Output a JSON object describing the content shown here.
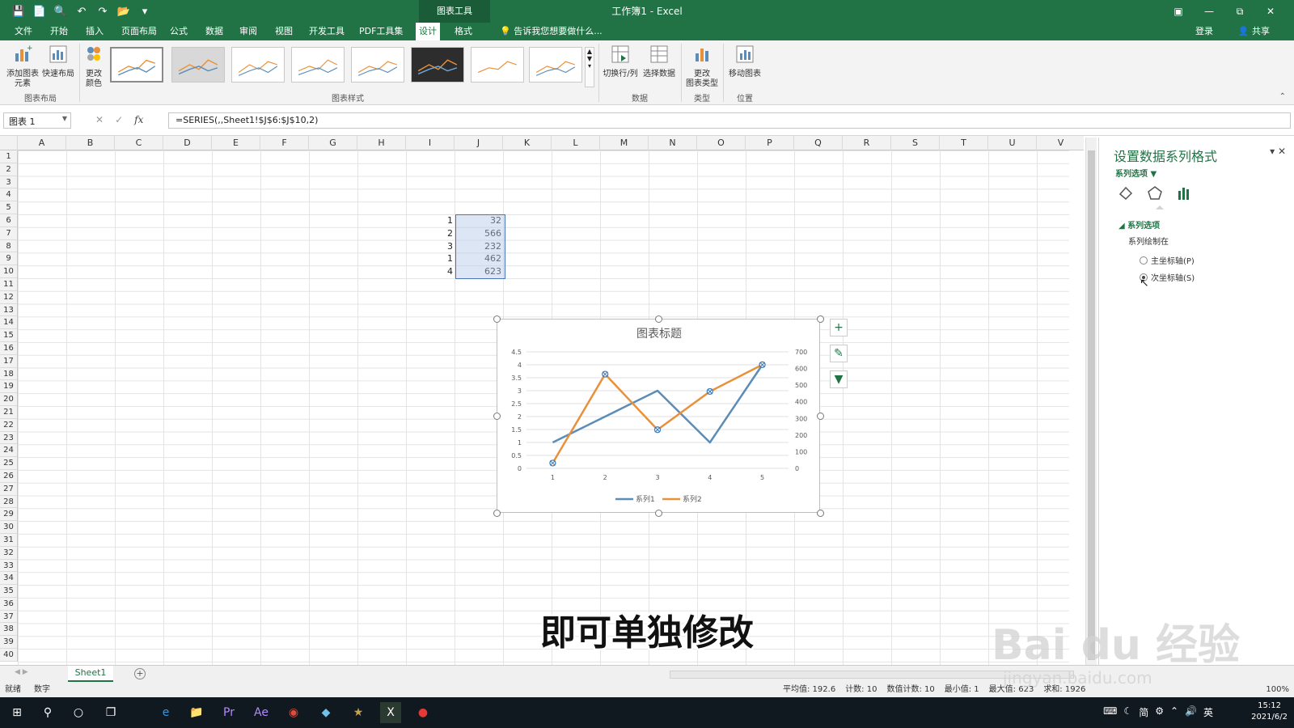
{
  "titlebar": {
    "tool_tab": "图表工具",
    "title": "工作簿1 - Excel"
  },
  "tabs": [
    "文件",
    "开始",
    "插入",
    "页面布局",
    "公式",
    "数据",
    "审阅",
    "视图",
    "开发工具",
    "PDF工具集",
    "设计",
    "格式"
  ],
  "active_tab": "设计",
  "tell_me": "告诉我您想要做什么...",
  "login": "登录",
  "share": "共享",
  "ribbon": {
    "add_element": "添加图表\n元素",
    "quick_layout": "快速布局",
    "change_color": "更改\n颜色",
    "group_layout": "图表布局",
    "group_styles": "图表样式",
    "switch_row_col": "切换行/列",
    "select_data": "选择数据",
    "group_data": "数据",
    "change_type": "更改\n图表类型",
    "group_type": "类型",
    "move_chart": "移动图表",
    "group_location": "位置"
  },
  "formula_bar": {
    "name_box": "图表 1",
    "formula": "=SERIES(,,Sheet1!$J$6:$J$10,2)"
  },
  "columns": [
    "A",
    "B",
    "C",
    "D",
    "E",
    "F",
    "G",
    "H",
    "I",
    "J",
    "K",
    "L",
    "M",
    "N",
    "O",
    "P",
    "Q",
    "R",
    "S",
    "T",
    "U",
    "V"
  ],
  "rows": [
    "1",
    "2",
    "3",
    "4",
    "5",
    "6",
    "7",
    "8",
    "9",
    "10",
    "11",
    "12",
    "13",
    "14",
    "15",
    "16",
    "17",
    "18",
    "19",
    "20",
    "21",
    "22",
    "23",
    "24",
    "25",
    "26",
    "27",
    "28",
    "29",
    "30",
    "31",
    "32",
    "33",
    "34",
    "35",
    "36",
    "37",
    "38",
    "39",
    "40"
  ],
  "cells": {
    "col_i": [
      "1",
      "2",
      "3",
      "1",
      "4"
    ],
    "col_j": [
      "32",
      "566",
      "232",
      "462",
      "623"
    ]
  },
  "chart_data": {
    "type": "line",
    "title": "图表标题",
    "categories": [
      1,
      2,
      3,
      4,
      5
    ],
    "series": [
      {
        "name": "系列1",
        "values": [
          1,
          2,
          3,
          1,
          4
        ],
        "axis": "primary",
        "color": "#5b8db8"
      },
      {
        "name": "系列2",
        "values": [
          32,
          566,
          232,
          462,
          623
        ],
        "axis": "secondary",
        "color": "#e8913a"
      }
    ],
    "y_primary": {
      "min": 0,
      "max": 4.5,
      "ticks": [
        "0",
        "0.5",
        "1",
        "1.5",
        "2",
        "2.5",
        "3",
        "3.5",
        "4",
        "4.5"
      ]
    },
    "y_secondary": {
      "min": 0,
      "max": 700,
      "ticks": [
        "0",
        "100",
        "200",
        "300",
        "400",
        "500",
        "600",
        "700"
      ]
    },
    "x_ticks": [
      "1",
      "2",
      "3",
      "4",
      "5"
    ],
    "legend": "bottom",
    "grid": true
  },
  "panel": {
    "title": "设置数据系列格式",
    "subtitle": "系列选项",
    "section": "系列选项",
    "plot_on": "系列绘制在",
    "primary_axis": "主坐标轴(P)",
    "secondary_axis": "次坐标轴(S)"
  },
  "sheet": {
    "tab": "Sheet1"
  },
  "status": {
    "ready": "就绪",
    "num": "数字",
    "stats": [
      "平均值: 192.6",
      "计数: 10",
      "数值计数: 10",
      "最小值: 1",
      "最大值: 623",
      "求和: 1926"
    ],
    "zoom": "100%"
  },
  "subtitle_caption": "即可单独修改",
  "watermark": {
    "brand": "Bai du 经验",
    "url": "jingyan.baidu.com"
  },
  "taskbar": {
    "time": "15:12",
    "date": "2021/6/2",
    "ime": "英",
    "lang": "简"
  },
  "colors": {
    "excel_green": "#217346",
    "series1": "#5b8db8",
    "series2": "#e8913a"
  }
}
